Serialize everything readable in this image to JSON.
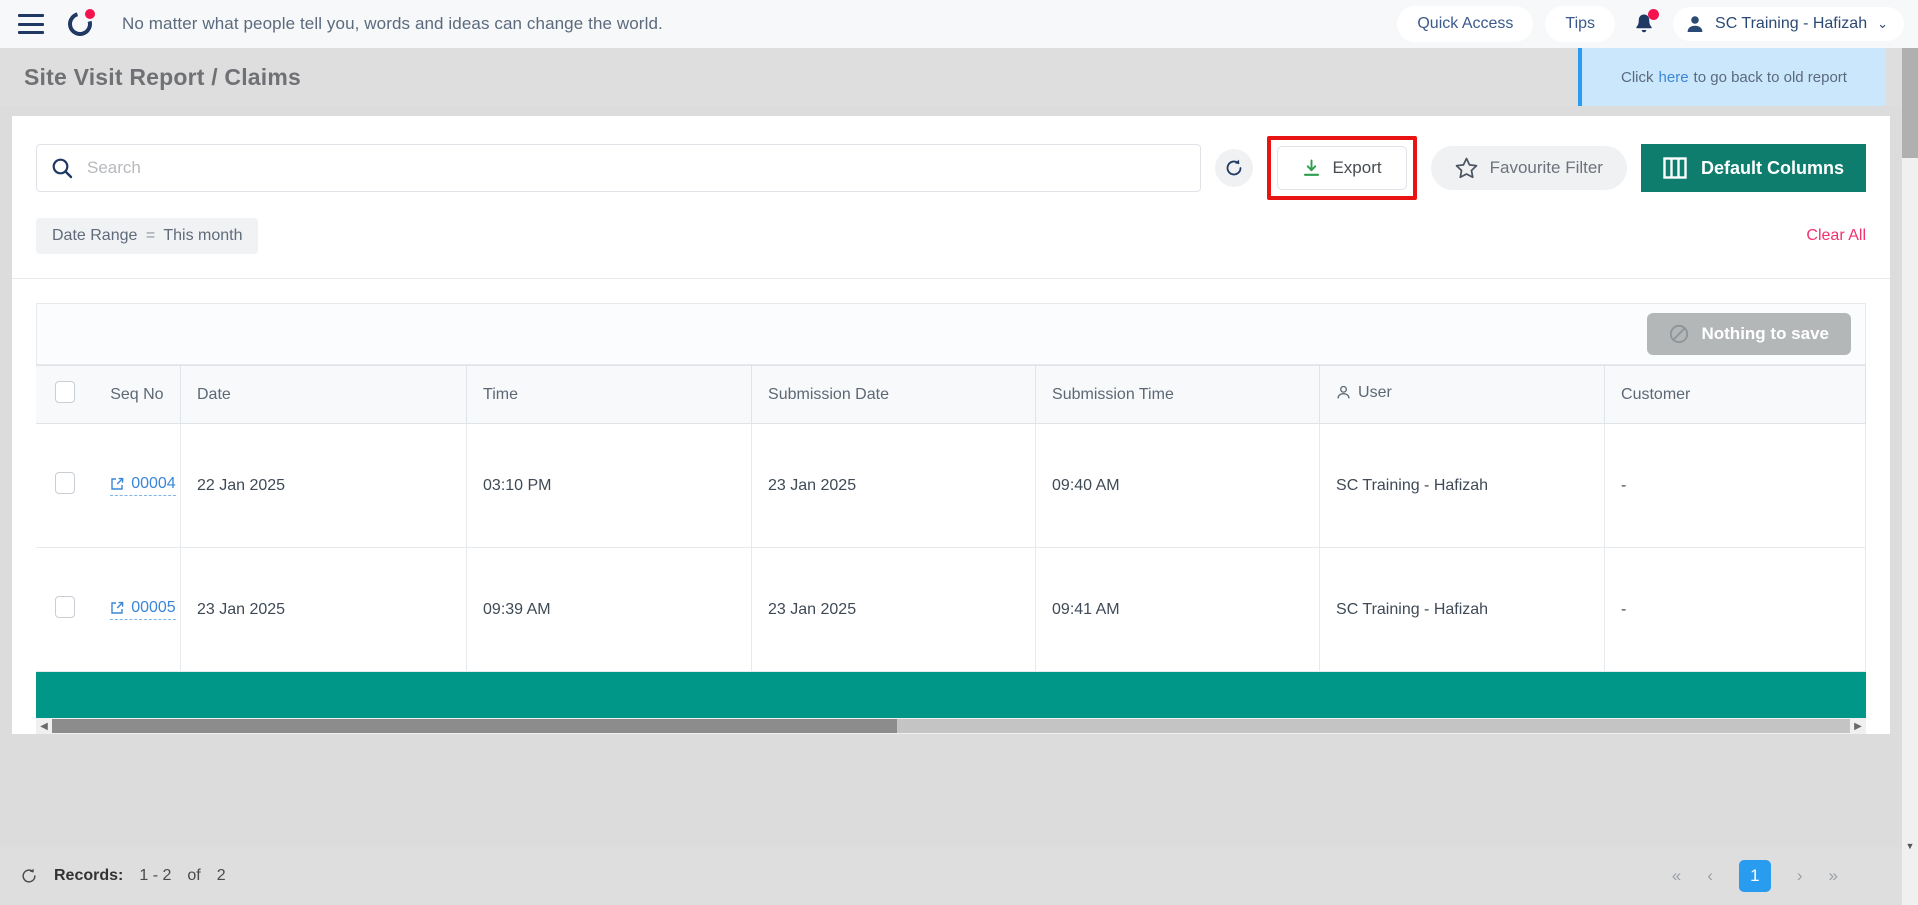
{
  "topnav": {
    "tagline": "No matter what people tell you, words and ideas can change the world.",
    "quick_access": "Quick Access",
    "tips": "Tips",
    "user": "SC Training - Hafizah",
    "chevron": "⌄"
  },
  "pagehead": {
    "title": "Site Visit Report / Claims",
    "old_report_pre": "Click",
    "old_report_link": "here",
    "old_report_post": "to go back to old report"
  },
  "toolbar": {
    "search_placeholder": "Search",
    "search_value": "",
    "export_label": "Export",
    "favourite_filter_label": "Favourite Filter",
    "default_columns_label": "Default Columns"
  },
  "filters": {
    "chip_field": "Date Range",
    "chip_operator": "=",
    "chip_value": "This month",
    "clear_all": "Clear All"
  },
  "save_strip": {
    "nothing_to_save": "Nothing to save"
  },
  "table": {
    "columns": [
      "Seq No",
      "Date",
      "Time",
      "Submission Date",
      "Submission Time",
      "User",
      "Customer"
    ],
    "rows": [
      {
        "seq_no": "00004",
        "date": "22 Jan 2025",
        "time": "03:10 PM",
        "submission_date": "23 Jan 2025",
        "submission_time": "09:40 AM",
        "user": "SC Training - Hafizah",
        "customer": "-"
      },
      {
        "seq_no": "00005",
        "date": "23 Jan 2025",
        "time": "09:39 AM",
        "submission_date": "23 Jan 2025",
        "submission_time": "09:41 AM",
        "user": "SC Training - Hafizah",
        "customer": "-"
      }
    ]
  },
  "footer": {
    "records_label": "Records:",
    "records_range": "1 - 2",
    "records_of": "of",
    "records_total": "2",
    "pager": {
      "first": "«",
      "prev": "‹",
      "current_page": "1",
      "next": "›",
      "last": "»"
    }
  },
  "colors": {
    "brand_navy": "#1f3864",
    "brand_pink": "#f3134f",
    "accent_teal": "#0e7d6e",
    "teal_bar": "#009688",
    "highlight_red": "#e81313",
    "link_blue": "#3a86d8",
    "page_active_blue": "#2a9cf0",
    "clear_all_pink": "#f0326e"
  }
}
